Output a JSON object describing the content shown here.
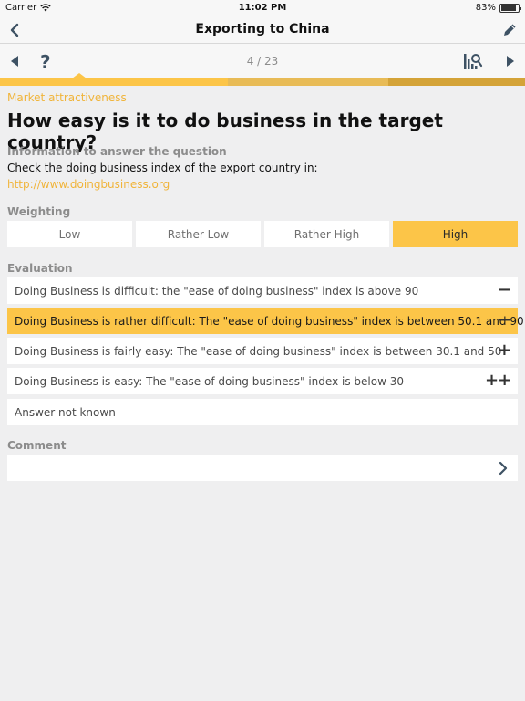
{
  "status": {
    "carrier": "Carrier",
    "time": "11:02 PM",
    "battery": "83%",
    "battery_level": 0.83
  },
  "nav": {
    "title": "Exporting to China",
    "back_icon": "chevron-left-icon",
    "edit_icon": "pencil-icon"
  },
  "toolbar": {
    "page_indicator": "4 / 23",
    "help_label": "?",
    "prev_icon": "triangle-left-icon",
    "next_icon": "triangle-right-icon",
    "stats_icon": "chart-search-icon"
  },
  "colors": {
    "accent": "#fcc548",
    "accent_text": "#f0b43a",
    "dark_icon": "#3e5264"
  },
  "question": {
    "category": "Market attractiveness",
    "text": "How easy is it to do business in the target country?",
    "info_label": "Information to answer the question",
    "info_text": "Check the doing business index of the export country in:",
    "info_link": "http://www.doingbusiness.org"
  },
  "weighting": {
    "label": "Weighting",
    "options": [
      "Low",
      "Rather Low",
      "Rather High",
      "High"
    ],
    "selected": "High"
  },
  "evaluation": {
    "label": "Evaluation",
    "items": [
      {
        "text": "Doing Business is difficult: the \"ease of doing business\" index is above 90",
        "mark": "−−",
        "selected": false
      },
      {
        "text": "Doing Business is rather difficult: The \"ease of doing business\" index is between 50.1 and 90",
        "mark": "−",
        "selected": true
      },
      {
        "text": "Doing Business is fairly easy: The \"ease of doing business\" index is between 30.1 and 50",
        "mark": "+",
        "selected": false
      },
      {
        "text": "Doing Business is easy: The \"ease of doing business\" index is below 30",
        "mark": "++",
        "selected": false
      },
      {
        "text": "Answer not known",
        "mark": "",
        "selected": false
      }
    ]
  },
  "comment": {
    "label": "Comment",
    "value": ""
  }
}
